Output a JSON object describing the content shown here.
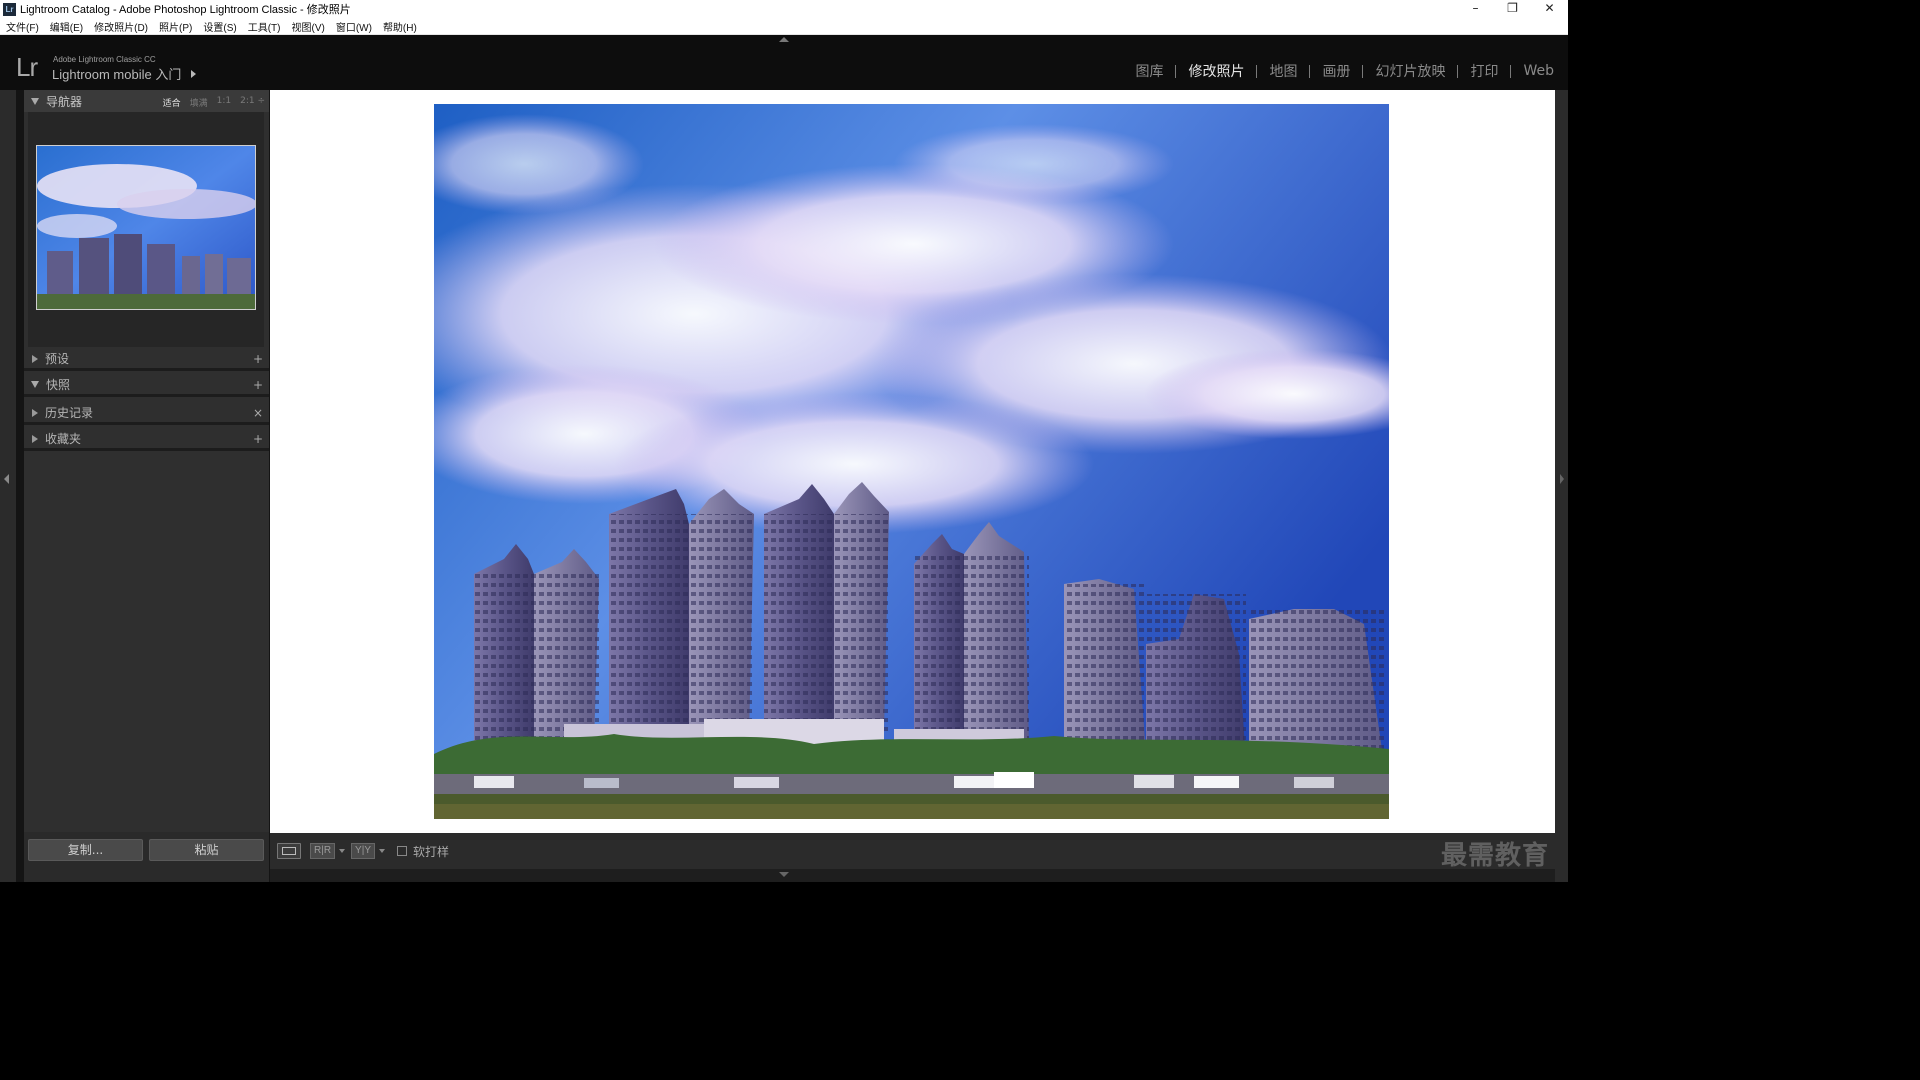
{
  "window": {
    "title": "Lightroom Catalog - Adobe Photoshop Lightroom Classic - 修改照片",
    "app_icon": "Lr",
    "controls": {
      "minimize": "–",
      "restore": "❐",
      "close": "✕"
    }
  },
  "menu": [
    "文件(F)",
    "编辑(E)",
    "修改照片(D)",
    "照片(P)",
    "设置(S)",
    "工具(T)",
    "视图(V)",
    "窗口(W)",
    "帮助(H)"
  ],
  "identity": {
    "logo": "Lr",
    "product": "Adobe Lightroom Classic CC",
    "mobile": "Lightroom mobile 入门"
  },
  "modules": [
    {
      "label": "图库",
      "active": false
    },
    {
      "label": "修改照片",
      "active": true
    },
    {
      "label": "地图",
      "active": false
    },
    {
      "label": "画册",
      "active": false
    },
    {
      "label": "幻灯片放映",
      "active": false
    },
    {
      "label": "打印",
      "active": false
    },
    {
      "label": "Web",
      "active": false
    }
  ],
  "left_panel": {
    "navigator": {
      "title": "导航器",
      "zoom_options": [
        "适合",
        "填满",
        "1:1",
        "2:1 ÷"
      ],
      "active_zoom": "适合"
    },
    "sections": [
      {
        "title": "预设",
        "expanded": false,
        "action": "+"
      },
      {
        "title": "快照",
        "expanded": true,
        "action": "+"
      },
      {
        "title": "历史记录",
        "expanded": false,
        "action": "×"
      },
      {
        "title": "收藏夹",
        "expanded": false,
        "action": "+"
      }
    ],
    "copy_button": "复制...",
    "paste_button": "粘贴"
  },
  "toolbar": {
    "view_loupe_icon": "loupe-view-icon",
    "before_after_lr": "R|R",
    "before_after_yy": "Y|Y",
    "soft_proof_label": "软打样",
    "soft_proof_checked": false
  },
  "watermark": "最需教育",
  "colors": {
    "panel_bg": "#2f2f2f",
    "canvas_bg": "#ffffff",
    "module_active": "#e6e6e6",
    "module_inactive": "#8a8a8a"
  }
}
